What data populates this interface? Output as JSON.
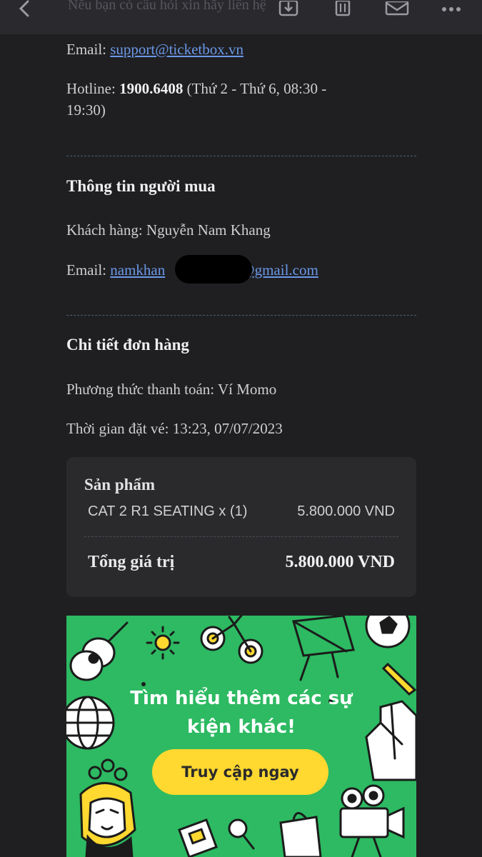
{
  "topbar": {
    "ghost_subject": "Nếu bạn có câu hỏi xin hãy liên hệ",
    "icons": [
      "back-icon",
      "download-icon",
      "trash-icon",
      "mail-icon",
      "more-icon"
    ]
  },
  "support": {
    "email_label": "Email: ",
    "email_value": "support@ticketbox.vn",
    "hotline_label": "Hotline: ",
    "hotline_number": "1900.6408",
    "hotline_hours_1": " (Thứ 2 - Thứ 6, 08:30 -",
    "hotline_hours_2": "19:30)"
  },
  "buyer": {
    "heading": "Thông tin người mua",
    "customer": "Khách hàng: Nguyễn Nam Khang",
    "email_label": "Email: ",
    "email_prefix": "namkhan",
    "email_suffix": "@gmail.com"
  },
  "order": {
    "heading": "Chi tiết đơn hàng",
    "payment": "Phương thức thanh toán: Ví Momo",
    "booked_at": "Thời gian đặt vé: 13:23, 07/07/2023"
  },
  "card": {
    "title": "Sản phẩm",
    "item": "CAT 2 R1 SEATING x (1)",
    "item_price": "5.800.000 VND",
    "total_label": "Tổng giá trị",
    "total_value": "5.800.000 VND"
  },
  "banner": {
    "line1": "Tìm hiểu thêm các sự",
    "line2": "kiện khác!",
    "cta": "Truy cập ngay",
    "bg_color": "#2dba62",
    "cta_color": "#ffd830"
  }
}
